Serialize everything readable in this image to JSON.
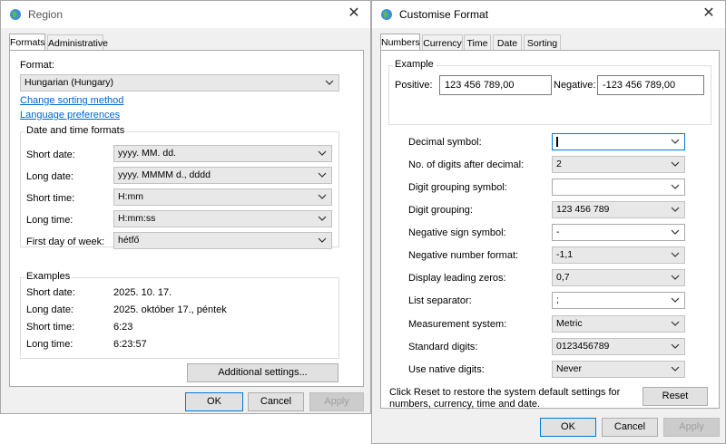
{
  "region": {
    "title": "Region",
    "tabs": [
      "Formats",
      "Administrative"
    ],
    "format_label": "Format:",
    "format_value": "Hungarian (Hungary)",
    "link_sorting": "Change sorting method",
    "link_language": "Language preferences",
    "date_group_title": "Date and time formats",
    "rows": [
      {
        "label": "Short date:",
        "value": "yyyy. MM. dd."
      },
      {
        "label": "Long date:",
        "value": "yyyy. MMMM d., dddd"
      },
      {
        "label": "Short time:",
        "value": "H:mm"
      },
      {
        "label": "Long time:",
        "value": "H:mm:ss"
      },
      {
        "label": "First day of week:",
        "value": "hétfő"
      }
    ],
    "examples_title": "Examples",
    "examples": [
      {
        "label": "Short date:",
        "value": "2025. 10. 17."
      },
      {
        "label": "Long date:",
        "value": "2025. október 17., péntek"
      },
      {
        "label": "Short time:",
        "value": "6:23"
      },
      {
        "label": "Long time:",
        "value": "6:23:57"
      }
    ],
    "additional_button": "Additional settings...",
    "ok": "OK",
    "cancel": "Cancel",
    "apply": "Apply"
  },
  "custom": {
    "title": "Customise Format",
    "tabs": [
      "Numbers",
      "Currency",
      "Time",
      "Date",
      "Sorting"
    ],
    "example_title": "Example",
    "positive_label": "Positive:",
    "positive_value": "123 456 789,00",
    "negative_label": "Negative:",
    "negative_value": "-123 456 789,00",
    "rows": [
      {
        "label": "Decimal symbol:",
        "value": ""
      },
      {
        "label": "No. of digits after decimal:",
        "value": "2"
      },
      {
        "label": "Digit grouping symbol:",
        "value": ""
      },
      {
        "label": "Digit grouping:",
        "value": "123 456 789"
      },
      {
        "label": "Negative sign symbol:",
        "value": "-"
      },
      {
        "label": "Negative number format:",
        "value": "-1,1"
      },
      {
        "label": "Display leading zeros:",
        "value": "0,7"
      },
      {
        "label": "List separator:",
        "value": ";"
      },
      {
        "label": "Measurement system:",
        "value": "Metric"
      },
      {
        "label": "Standard digits:",
        "value": "0123456789"
      },
      {
        "label": "Use native digits:",
        "value": "Never"
      }
    ],
    "reset_text_line1": "Click Reset to restore the system default settings for",
    "reset_text_line2": "numbers, currency, time and date.",
    "reset_button": "Reset",
    "ok": "OK",
    "cancel": "Cancel",
    "apply": "Apply"
  },
  "colors": {
    "accent": "#0078d7",
    "link": "#0066cc"
  }
}
